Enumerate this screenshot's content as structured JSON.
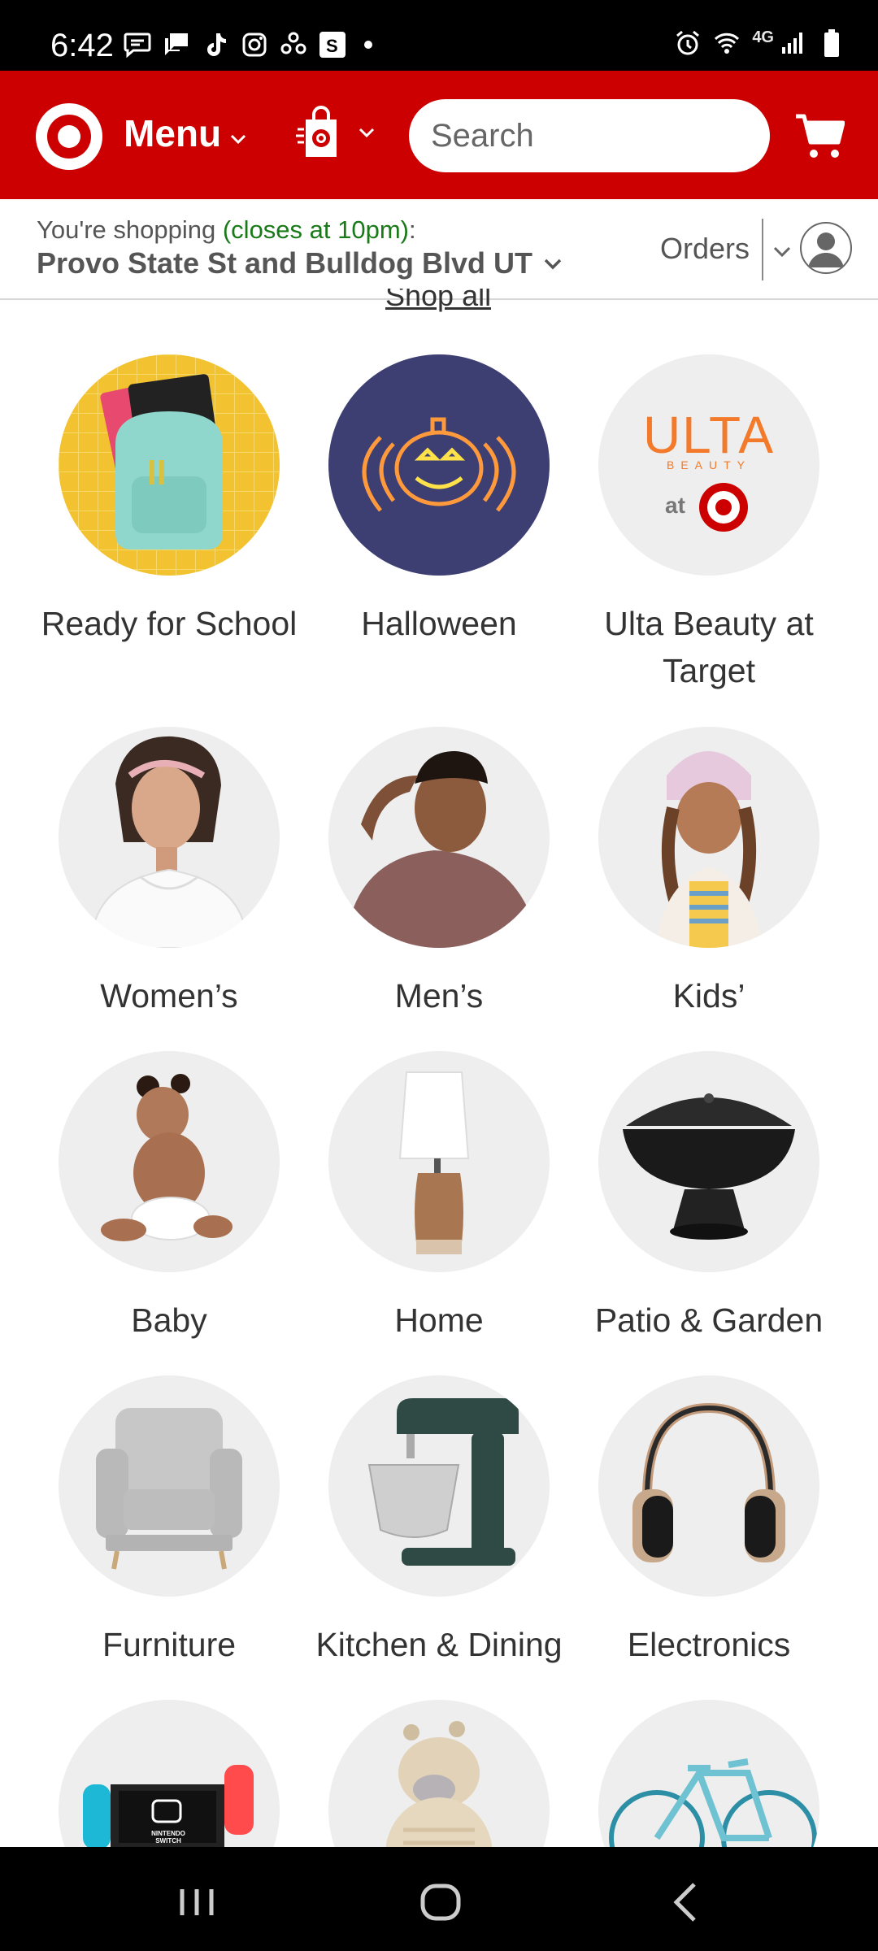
{
  "status_bar": {
    "time": "6:42",
    "network": "4G",
    "icons": [
      "messages-icon",
      "chat-icon",
      "tiktok-icon",
      "instagram-icon",
      "app-icon",
      "s-app-icon",
      "alarm-icon",
      "wifi-icon",
      "signal-icon",
      "battery-icon"
    ]
  },
  "header": {
    "menu_label": "Menu",
    "search_placeholder": "Search",
    "colors": {
      "brand_red": "#cc0000"
    }
  },
  "shopping": {
    "prefix": "You're shopping ",
    "hours": "(closes at 10pm)",
    "suffix": ":",
    "store": "Provo State St and Bulldog Blvd UT",
    "orders": "Orders"
  },
  "shop_all": "Shop all",
  "categories": [
    {
      "label": "Ready for School",
      "icon": "backpack-image"
    },
    {
      "label": "Halloween",
      "icon": "pumpkin-image"
    },
    {
      "label": "Ulta Beauty at Target",
      "icon": "ulta-logo-image",
      "logo_text": "ULTA",
      "logo_sub": "BEAUTY",
      "logo_at": "at"
    },
    {
      "label": "Women’s",
      "icon": "woman-image"
    },
    {
      "label": "Men’s",
      "icon": "man-image"
    },
    {
      "label": "Kids’",
      "icon": "kid-image"
    },
    {
      "label": "Baby",
      "icon": "baby-image"
    },
    {
      "label": "Home",
      "icon": "lamp-image"
    },
    {
      "label": "Patio & Garden",
      "icon": "fire-pit-image"
    },
    {
      "label": "Furniture",
      "icon": "armchair-image"
    },
    {
      "label": "Kitchen & Dining",
      "icon": "stand-mixer-image"
    },
    {
      "label": "Electronics",
      "icon": "headphones-image"
    },
    {
      "label": "",
      "icon": "nintendo-switch-image",
      "logo_text": "NINTENDO SWITCH"
    },
    {
      "label": "",
      "icon": "plush-giraffe-image"
    },
    {
      "label": "",
      "icon": "bicycle-image"
    }
  ],
  "nav": {
    "buttons": [
      "recents-button",
      "home-button",
      "back-button"
    ]
  }
}
